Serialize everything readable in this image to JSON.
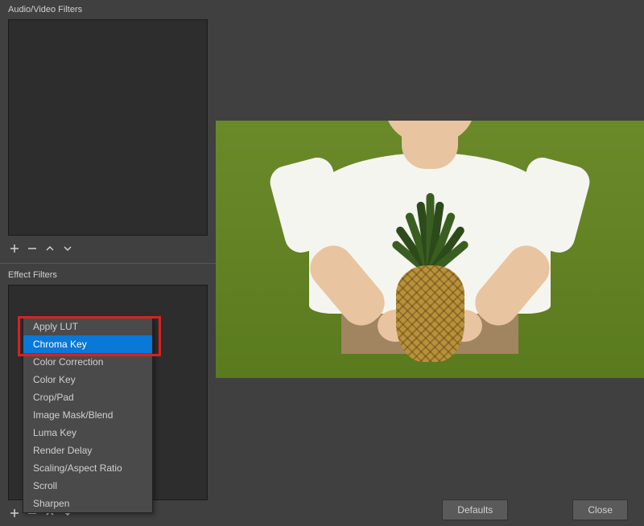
{
  "left": {
    "av_header": "Audio/Video Filters",
    "effect_header": "Effect Filters",
    "controls": {
      "add": "+",
      "remove": "−",
      "up": "▲",
      "down": "▼"
    }
  },
  "popup": {
    "items": [
      "Apply LUT",
      "Chroma Key",
      "Color Correction",
      "Color Key",
      "Crop/Pad",
      "Image Mask/Blend",
      "Luma Key",
      "Render Delay",
      "Scaling/Aspect Ratio",
      "Scroll",
      "Sharpen"
    ],
    "highlighted_index": 1
  },
  "buttons": {
    "defaults": "Defaults",
    "close": "Close"
  }
}
